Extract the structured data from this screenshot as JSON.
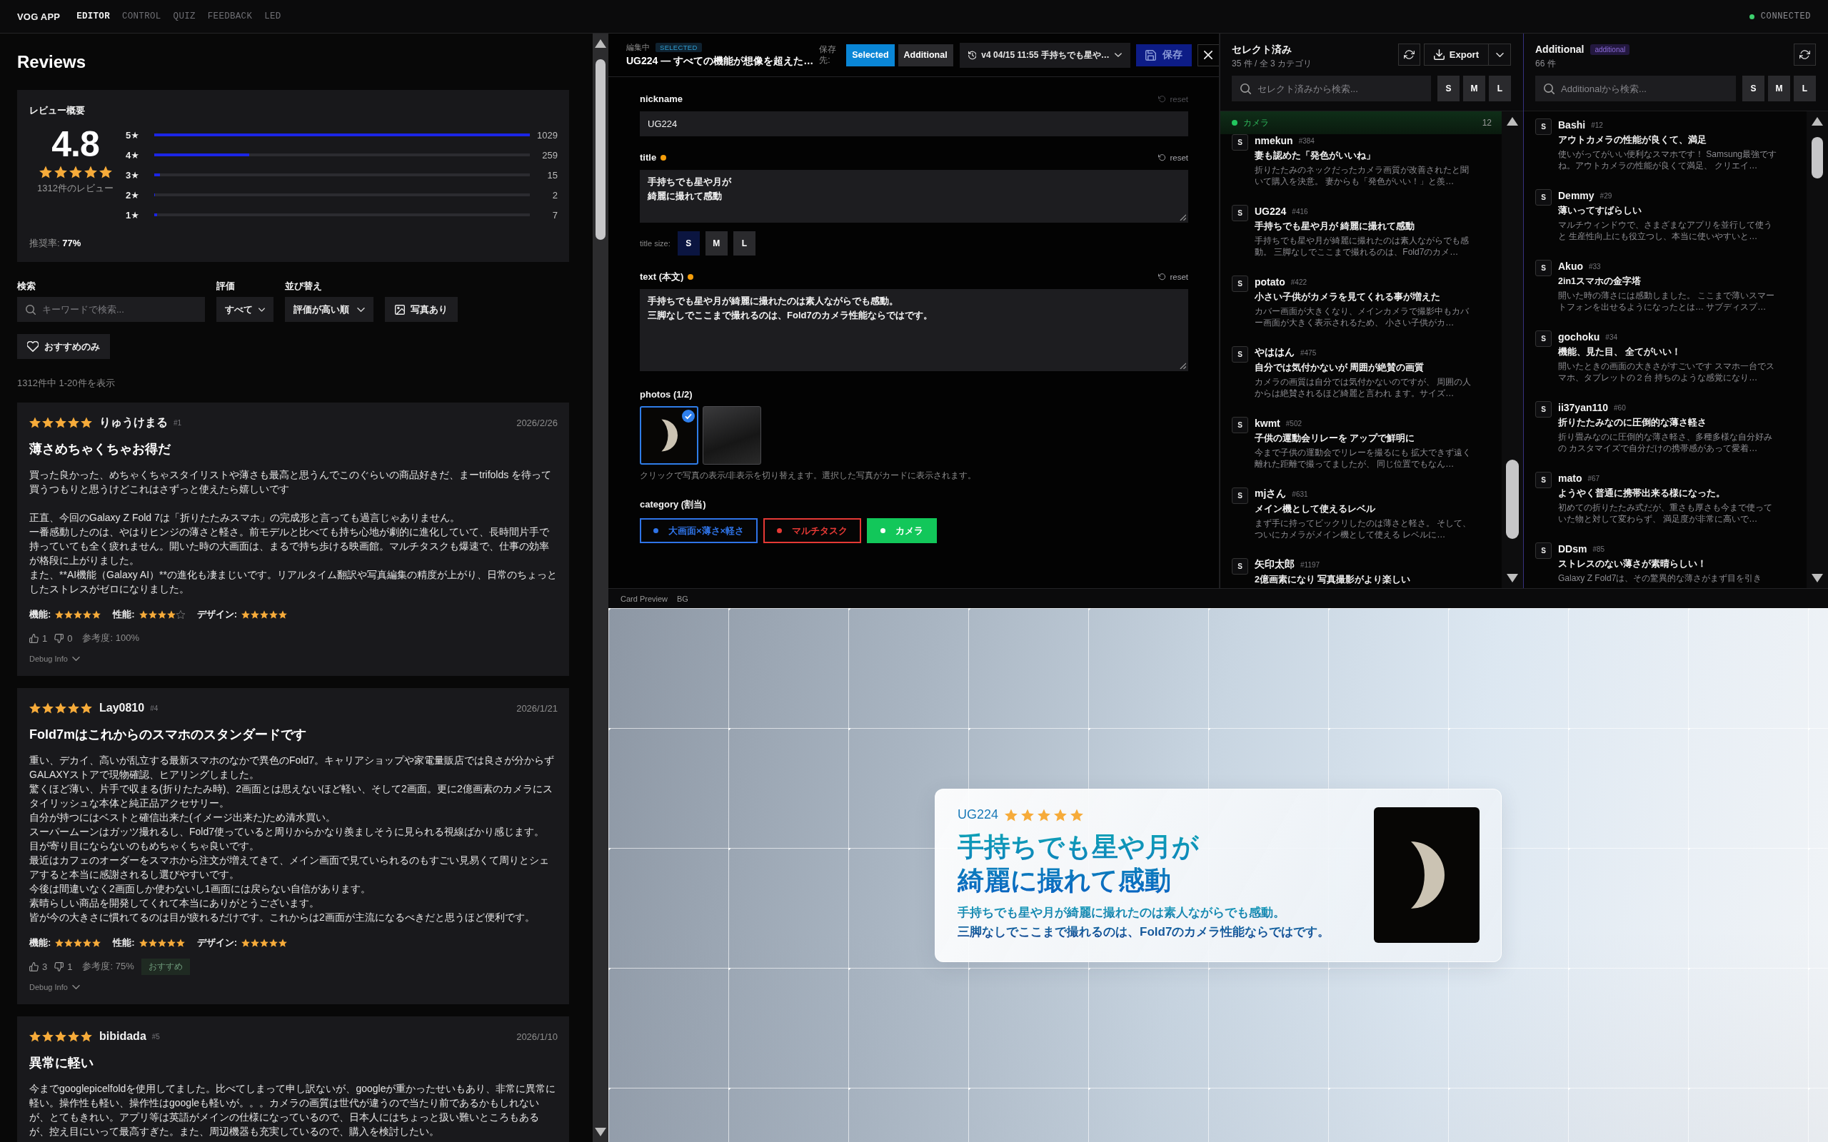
{
  "header": {
    "brand": "VOG APP",
    "tabs": [
      {
        "label": "EDITOR",
        "selected": true
      },
      {
        "label": "CONTROL",
        "selected": false
      },
      {
        "label": "QUIZ",
        "selected": false
      },
      {
        "label": "FEEDBACK",
        "selected": false
      },
      {
        "label": "LED",
        "selected": false
      }
    ],
    "connection": {
      "label": "CONNECTED",
      "connected": true
    }
  },
  "reviews": {
    "title": "Reviews",
    "summary": {
      "heading": "レビュー概要",
      "average": "4.8",
      "stars": 5,
      "count": "1312件のレビュー",
      "distribution": [
        {
          "label": "5★",
          "level": 1,
          "count": "1029"
        },
        {
          "label": "4★",
          "level": 0.252,
          "count": "259"
        },
        {
          "label": "3★",
          "level": 0.015,
          "count": "15"
        },
        {
          "label": "2★",
          "level": 0.002,
          "count": "2"
        },
        {
          "label": "1★",
          "level": 0.007,
          "count": "7"
        }
      ],
      "recommend": "推奨率: **77%**"
    },
    "filters": {
      "search": {
        "label": "検索",
        "placeholder": "キーワードで検索..."
      },
      "rating": {
        "label": "評価",
        "value": "すべて"
      },
      "sort": {
        "label": "並び替え",
        "value": "評価が高い順"
      },
      "photo_button": "写真あり",
      "recommended_button": "おすすめのみ"
    },
    "result_count": "1312件中 1-20件を表示",
    "items": [
      {
        "stars": 5,
        "name": "りゅうけまる",
        "number": "#1",
        "date": "2026/2/26",
        "title": "薄さめちゃくちゃお得だ",
        "body": [
          [
            "買った良かった、めちゃくちゃスタイリストや薄さも最高と思うんでこのぐらいの商品好きだ、まーtrifolds を待って買うつもりと思うけどこれはさずっと使えたら嬉しいです"
          ],
          [
            "正直、今回のGalaxy Z Fold 7は「折りたたみスマホ」の完成形と言っても過言じゃありません。",
            "一番感動したのは、やはりヒンジの薄さと軽さ。前モデルと比べても持ち心地が劇的に進化していて、長時間片手で持っていても全く疲れません。開いた時の大画面は、まるで持ち歩ける映画館。マルチタスクも爆速で、仕事の効率が格段に上がりました。",
            "また、**AI機能（Galaxy AI）**の進化も凄まじいです。リアルタイム翻訳や写真編集の精度が上がり、日常のちょっとしたストレスがゼロになりました。"
          ]
        ],
        "ratings": [
          {
            "label": "機能:",
            "stars": 5
          },
          {
            "label": "性能:",
            "stars": 4
          },
          {
            "label": "デザイン:",
            "stars": 5
          }
        ],
        "likes": "1",
        "dislikes": "0",
        "helpful": "参考度: 100%",
        "debug": {
          "label": "Debug Info",
          "expanded": false
        }
      },
      {
        "stars": 5,
        "name": "Lay0810",
        "number": "#4",
        "date": "2026/1/21",
        "title": "Fold7mはこれからのスマホのスタンダードです",
        "body": [
          [
            "重い、デカイ、高いが乱立する最新スマホのなかで異色のFold7。キャリアショップや家電量販店では良さが分からずGALAXYストアで現物確認、ヒアリングしました。",
            "驚くほど薄い、片手で収まる(折りたたみ時)、2画面とは思えないほど軽い、そして2画面。更に2億画素のカメラにスタイリッシュな本体と純正品アクセサリー。",
            "自分が持つにはベストと確信出来た(イメージ出来た)ため清水買い。",
            "スーパームーンはガッツ撮れるし、Fold7使っていると周りからかなり羨ましそうに見られる視線ばかり感じます。",
            "目が寄り目にならないのもめちゃくちゃ良いです。",
            "最近はカフェのオーダーをスマホから注文が増えてきて、メイン画面で見ていられるのもすごい見易くて周りとシェアすると本当に感謝されるし選びやすいです。",
            "今後は間違いなく2画面しか使わないし1画面には戻らない自信があります。",
            "素晴らしい商品を開発してくれて本当にありがとうございます。",
            "皆が今の大きさに慣れてるのは目が疲れるだけです。これからは2画面が主流になるべきだと思うほど便利です。"
          ]
        ],
        "ratings": [
          {
            "label": "機能:",
            "stars": 5
          },
          {
            "label": "性能:",
            "stars": 5
          },
          {
            "label": "デザイン:",
            "stars": 5
          }
        ],
        "likes": "3",
        "dislikes": "1",
        "helpful": "参考度: 75%",
        "badge": "おすすめ",
        "debug": {
          "label": "Debug Info",
          "expanded": false
        }
      },
      {
        "stars": 5,
        "name": "bibidada",
        "number": "#5",
        "date": "2026/1/10",
        "title": "異常に軽い",
        "body": [
          [
            "今までgooglepicelfoldを使用してました。比べてしまって申し訳ないが、googleが重かったせいもあり、非常に異常に軽い。操作性も軽い、操作性はgoogleも軽いが。。。カメラの画質は世代が違うので当たり前であるかもしれないが、とてもきれい。アプリ等は英語がメインの仕様になっているので、日本人にはちょっと扱い難いところもあるが、控え目にいって最高すぎた。また、周辺機器も充実しているので、購入を検討したい。"
          ]
        ]
      }
    ]
  },
  "editor": {
    "header": {
      "status_label": "編集中",
      "badge": "SELECTED",
      "title": "UG224 — すべての機能が想像を超えた…",
      "destination_label": "保存先:",
      "destinations": [
        {
          "label": "Selected",
          "selected": true
        },
        {
          "label": "Additional",
          "selected": false
        }
      ],
      "version": "v4 04/15 11:55 手持ちでも星や…",
      "save_label": "保存"
    },
    "fields": [
      {
        "kind": "input",
        "label": "nickname",
        "modified": false,
        "reset_label": "reset",
        "value": "UG224"
      },
      {
        "kind": "textarea",
        "label": "title",
        "modified": true,
        "reset_label": "reset",
        "lines": [
          "手持ちでも星や月が",
          "綺麗に撮れて感動"
        ],
        "size_label": "title size:",
        "sizes": [
          {
            "label": "S",
            "selected": true
          },
          {
            "label": "M",
            "selected": false
          },
          {
            "label": "L",
            "selected": false
          }
        ]
      },
      {
        "kind": "textarea",
        "label": "text (本文)",
        "modified": true,
        "reset_label": "reset",
        "lines": [
          "手持ちでも星や月が綺麗に撮れたのは素人ながらでも感動。",
          "三脚なしでここまで撮れるのは、Fold7のカメラ性能ならではです。"
        ]
      }
    ],
    "photos": {
      "label": "photos (1/2)",
      "items": [
        {
          "kind": "moon",
          "selected": true
        },
        {
          "kind": "street",
          "selected": false
        }
      ],
      "hint": "クリックで写真の表示/非表示を切り替えます。選択した写真がカードに表示されます。"
    },
    "category": {
      "label": "category (割当)",
      "chips": [
        {
          "label": "大画面×薄さ×軽さ",
          "color": "#2f74e8",
          "selected": false
        },
        {
          "label": "マルチタスク",
          "color": "#e53935",
          "selected": false
        },
        {
          "label": "カメラ",
          "color": "#12c75a",
          "selected": true
        }
      ]
    }
  },
  "columns": [
    {
      "kind": "selected",
      "title": "セレクト済み",
      "subtitle": "35 件 / 全 3 カテゴリ",
      "export_label": "Export",
      "search_placeholder": "セレクト済みから検索...",
      "sizes": [
        {
          "label": "S",
          "selected": false
        },
        {
          "label": "M",
          "selected": false
        },
        {
          "label": "L",
          "selected": false
        }
      ],
      "groups": [
        {
          "label": "カメラ",
          "count": "12",
          "items": [
            {
              "size": "S",
              "name": "nmekun",
              "number": "#384",
              "title": "妻も認めた「発色がいいね」",
              "snippet": "折りたたみのネックだったカメラ画質が改善されたと聞いて購入を決意。 妻からも「発色がいい！」と羨…"
            },
            {
              "size": "S",
              "name": "UG224",
              "number": "#416",
              "title": "手持ちでも星や月が 綺麗に撮れて感動",
              "snippet": "手持ちでも星や月が綺麗に撮れたのは素人ながらでも感動。 三脚なしでここまで撮れるのは、Fold7のカメ…"
            },
            {
              "size": "S",
              "name": "potato",
              "number": "#422",
              "title": "小さい子供がカメラを見てくれる事が増えた",
              "snippet": "カバー画面が大きくなり、メインカメラで撮影中もカバー画面が大きく表示されるため、 小さい子供がカ…"
            },
            {
              "size": "S",
              "name": "やははん",
              "number": "#475",
              "title": "自分では気付かないが 周囲が絶賛の画質",
              "snippet": "カメラの画質は自分では気付かないのですが、 周囲の人からは絶賛されるほど綺麗と言われ ます。サイズ…"
            },
            {
              "size": "S",
              "name": "kwmt",
              "number": "#502",
              "title": "子供の運動会リレーを アップで鮮明に",
              "snippet": "今まで子供の運動会でリレーを撮るにも 拡大できず遠く離れた距離で撮ってましたが、 同じ位置でもなん…"
            },
            {
              "size": "S",
              "name": "mjさん",
              "number": "#631",
              "title": "メイン機として使えるレベル",
              "snippet": "まず手に持ってビックリしたのは薄さと軽さ。 そして、ついにカメラがメイン機として使える レベルに…"
            },
            {
              "size": "S",
              "name": "矢印太郎",
              "number": "#1197",
              "title": "2億画素になり 写真撮影がより楽しい"
            }
          ]
        }
      ]
    },
    {
      "kind": "additional",
      "title": "Additional",
      "badge": "additional",
      "subtitle": "66 件",
      "search_placeholder": "Additionalから検索...",
      "sizes": [
        {
          "label": "S",
          "selected": false
        },
        {
          "label": "M",
          "selected": false
        },
        {
          "label": "L",
          "selected": false
        }
      ],
      "items": [
        {
          "size": "S",
          "name": "Bashi",
          "number": "#12",
          "title": "アウトカメラの性能が良くて、満足",
          "snippet": "使いがってがいい便利なスマホです！ Samsung最強ですね。アウトカメラの性能が良くて満足、 クリエイ…"
        },
        {
          "size": "S",
          "name": "Demmy",
          "number": "#29",
          "title": "薄いってすばらしい",
          "snippet": "マルチウィンドウで、さまざまなアプリを並行して使うと 生産性向上にも役立つし、本当に使いやすいと…"
        },
        {
          "size": "S",
          "name": "Akuo",
          "number": "#33",
          "title": "2in1スマホの金字塔",
          "snippet": "開いた時の薄さには感動しました。 ここまで薄いスマートフォンを出せるようになったとは… サブディスプ…"
        },
        {
          "size": "S",
          "name": "gochoku",
          "number": "#34",
          "title": "機能、見た目、 全てがいい！",
          "snippet": "開いたときの画面の大きさがすごいです スマホ一台でスマホ、タブレットの２台 持ちのような感覚になり…"
        },
        {
          "size": "S",
          "name": "ii37yan110",
          "number": "#60",
          "title": "折りたたみなのに圧倒的な薄さ軽さ",
          "snippet": "折り畳みなのに圧倒的な薄さ軽さ、多種多様な自分好みの カスタマイズで自分だけの携帯感があって愛着…"
        },
        {
          "size": "S",
          "name": "mato",
          "number": "#67",
          "title": "ようやく普通に携帯出来る様になった。",
          "snippet": "初めての折りたたみ式だが、重さも厚さも今まで使っていた物と対して変わらず、 満足度が非常に高いで…"
        },
        {
          "size": "S",
          "name": "DDsm",
          "number": "#85",
          "title": "ストレスのない薄さが素晴らしい！",
          "snippet": "Galaxy Z Fold7は、その驚異的な薄さがまず目を引き"
        }
      ]
    }
  ],
  "preview": {
    "label": "Card Preview",
    "bg_button": "BG",
    "card": {
      "nickname": "UG224",
      "stars": 5,
      "title_lines": [
        "手持ちでも星や月が",
        "綺麗に撮れて感動"
      ],
      "text_lines": [
        "手持ちでも星や月が綺麗に撮れたのは素人ながらでも感動。",
        "三脚なしでここまで撮れるのは、Fold7のカメラ性能ならではです。"
      ],
      "photo": {
        "kind": "moon"
      }
    }
  }
}
